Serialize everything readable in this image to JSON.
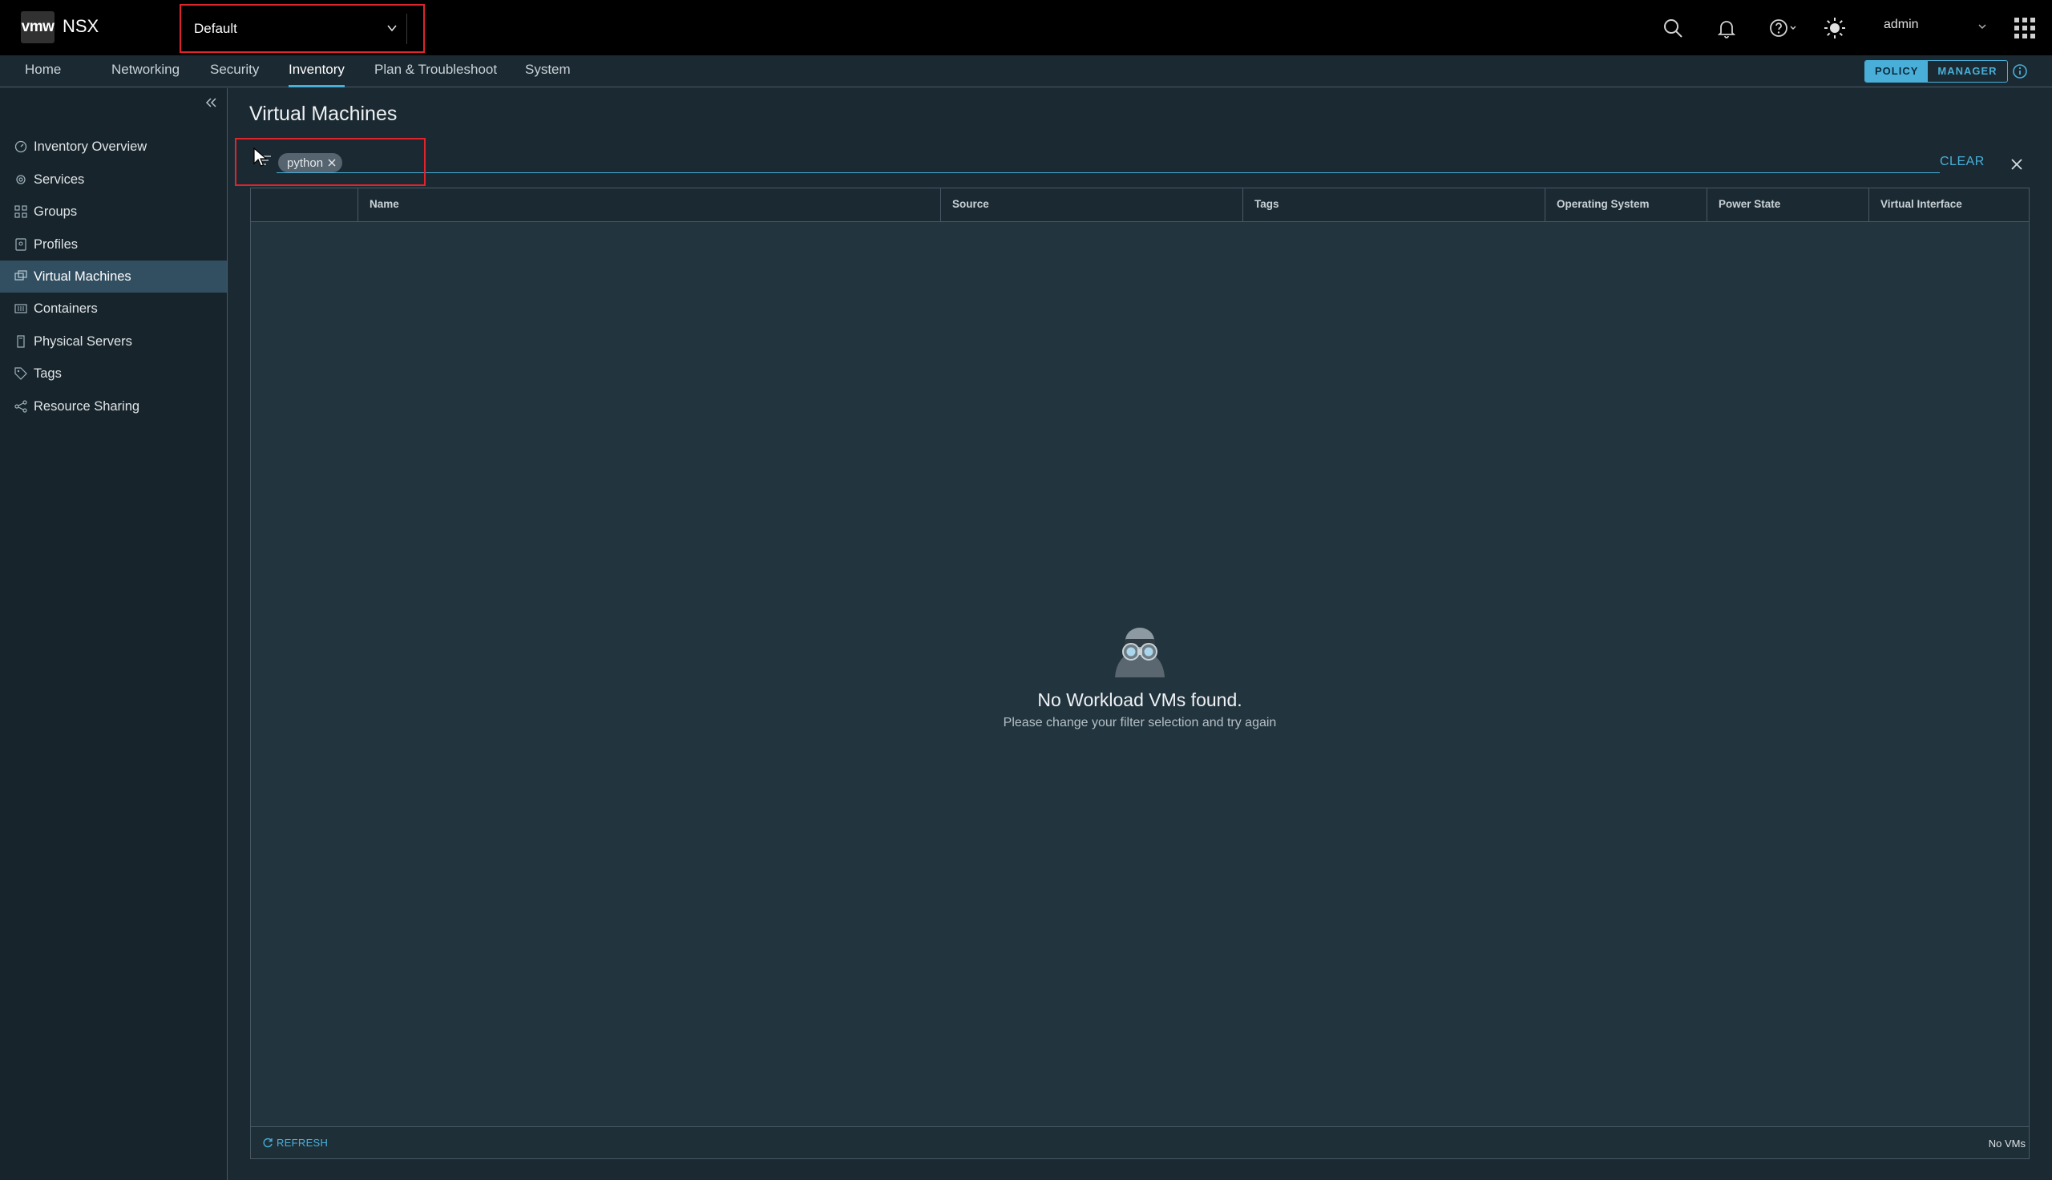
{
  "header": {
    "logo_text": "vmw",
    "product_name": "NSX",
    "project_selector": "Default",
    "user": "admin"
  },
  "nav": {
    "items": [
      "Home",
      "Networking",
      "Security",
      "Inventory",
      "Plan & Troubleshoot",
      "System"
    ],
    "active": "Inventory",
    "mode_policy": "POLICY",
    "mode_manager": "MANAGER"
  },
  "sidebar": {
    "items": [
      {
        "label": "Inventory Overview",
        "icon": "dashboard-icon"
      },
      {
        "label": "Services",
        "icon": "services-icon"
      },
      {
        "label": "Groups",
        "icon": "groups-icon"
      },
      {
        "label": "Profiles",
        "icon": "profiles-icon"
      },
      {
        "label": "Virtual Machines",
        "icon": "vm-icon"
      },
      {
        "label": "Containers",
        "icon": "containers-icon"
      },
      {
        "label": "Physical Servers",
        "icon": "server-icon"
      },
      {
        "label": "Tags",
        "icon": "tag-icon"
      },
      {
        "label": "Resource Sharing",
        "icon": "share-icon"
      }
    ],
    "active": "Virtual Machines"
  },
  "main": {
    "title": "Virtual Machines",
    "filter_chip": "python",
    "clear_label": "CLEAR",
    "columns": [
      "Name",
      "Source",
      "Tags",
      "Operating System",
      "Power State",
      "Virtual Interface"
    ],
    "empty_title": "No Workload VMs found.",
    "empty_subtitle": "Please change your filter selection and try again",
    "refresh_label": "REFRESH",
    "footer_count": "No VMs"
  },
  "colors": {
    "accent": "#49afd9",
    "highlight": "#e0242b",
    "header_bg": "#000000",
    "page_bg": "#1b2a32"
  }
}
